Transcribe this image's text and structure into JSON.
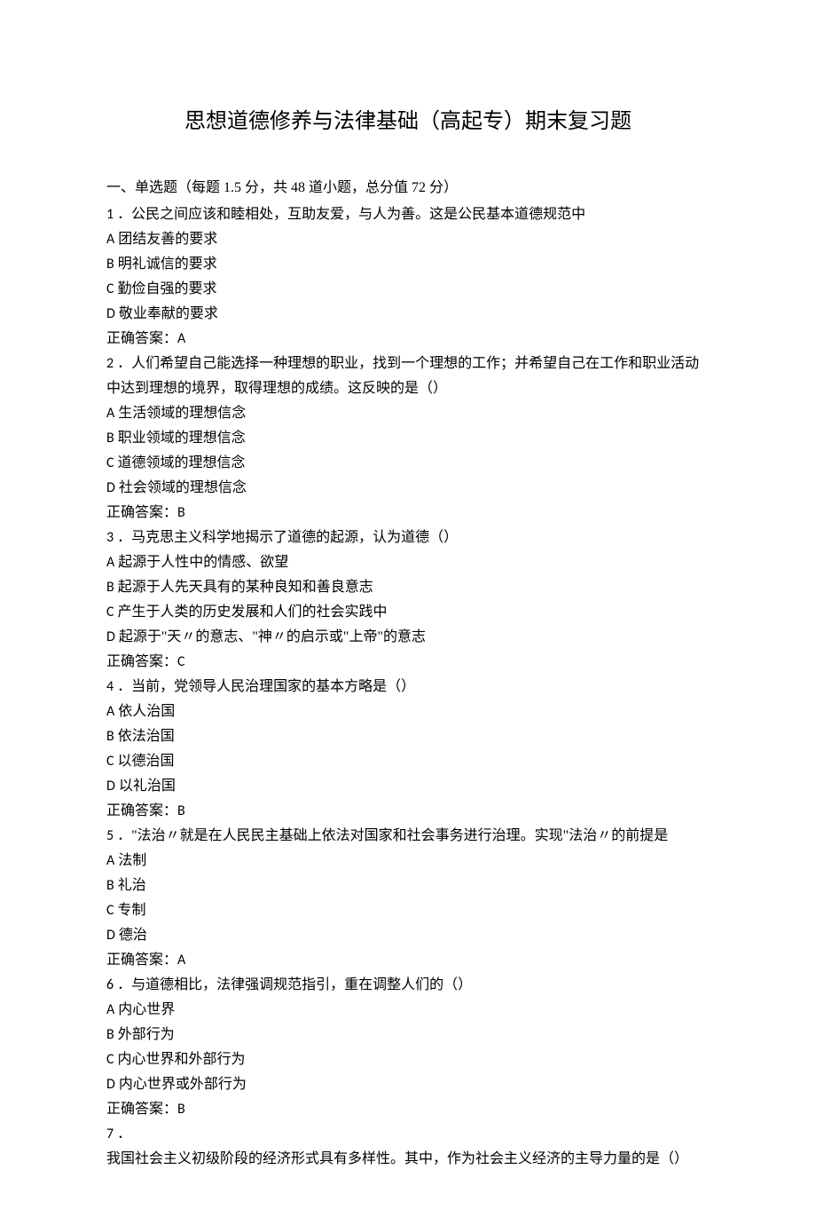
{
  "title": "思想道德修养与法律基础（高起专）期末复习题",
  "section_header": "一、单选题（每题 1.5 分，共 48 道小题，总分值 72 分）",
  "questions": [
    {
      "num": "1",
      "sep": " ．",
      "text": "公民之间应该和睦相处，互助友爱，与人为善。这是公民基本道德规范中",
      "options": [
        {
          "letter": "A",
          "text": " 团结友善的要求"
        },
        {
          "letter": "B",
          "text": " 明礼诚信的要求"
        },
        {
          "letter": "C",
          "text": " 勤俭自强的要求"
        },
        {
          "letter": "D",
          "text": " 敬业奉献的要求"
        }
      ],
      "answer_label": "正确答案：",
      "answer_value": "A"
    },
    {
      "num": "2",
      "sep": " ．",
      "text": "人们希望自己能选择一种理想的职业，找到一个理想的工作；并希望自己在工作和职业活动中达到理想的境界，取得理想的成绩。这反映的是（）",
      "options": [
        {
          "letter": "A",
          "text": " 生活领域的理想信念"
        },
        {
          "letter": "B",
          "text": " 职业领域的理想信念"
        },
        {
          "letter": "C",
          "text": " 道德领域的理想信念"
        },
        {
          "letter": "D",
          "text": " 社会领域的理想信念"
        }
      ],
      "answer_label": "正确答案：",
      "answer_value": "B"
    },
    {
      "num": "3",
      "sep": " ．",
      "text": "马克思主义科学地揭示了道德的起源，认为道德（）",
      "options": [
        {
          "letter": "A",
          "text": " 起源于人性中的情感、欲望"
        },
        {
          "letter": "B",
          "text": " 起源于人先天具有的某种良知和善良意志"
        },
        {
          "letter": "C",
          "text": " 产生于人类的历史发展和人们的社会实践中"
        },
        {
          "letter": "D",
          "text": " 起源于\"天〃的意志、\"神〃的启示或\"上帝\"的意志"
        }
      ],
      "answer_label": "正确答案：",
      "answer_value": "C"
    },
    {
      "num": "4",
      "sep": " ．",
      "text": "当前，党领导人民治理国家的基本方略是（）",
      "options": [
        {
          "letter": "A",
          "text": " 依人治国"
        },
        {
          "letter": "B",
          "text": " 依法治国"
        },
        {
          "letter": "C",
          "text": " 以德治国"
        },
        {
          "letter": "D",
          "text": " 以礼治国"
        }
      ],
      "answer_label": "正确答案：",
      "answer_value": "B"
    },
    {
      "num": "5",
      "sep": " ．",
      "text": "\"法治〃就是在人民民主基础上依法对国家和社会事务进行治理。实现\"法治〃的前提是",
      "options": [
        {
          "letter": "A",
          "text": " 法制"
        },
        {
          "letter": "B",
          "text": " 礼治"
        },
        {
          "letter": "C",
          "text": " 专制"
        },
        {
          "letter": "D",
          "text": " 德治"
        }
      ],
      "answer_label": "正确答案：",
      "answer_value": "A"
    },
    {
      "num": "6",
      "sep": " ．",
      "text": "与道德相比，法律强调规范指引，重在调整人们的（）",
      "options": [
        {
          "letter": "A",
          "text": " 内心世界"
        },
        {
          "letter": "B",
          "text": " 外部行为"
        },
        {
          "letter": "C",
          "text": " 内心世界和外部行为"
        },
        {
          "letter": "D",
          "text": " 内心世界或外部行为"
        }
      ],
      "answer_label": "正确答案：",
      "answer_value": "B"
    },
    {
      "num": "7",
      "sep": " ．",
      "text": "我国社会主义初级阶段的经济形式具有多样性。其中，作为社会主义经济的主导力量的是（）",
      "options": [],
      "answer_label": "",
      "answer_value": ""
    }
  ]
}
